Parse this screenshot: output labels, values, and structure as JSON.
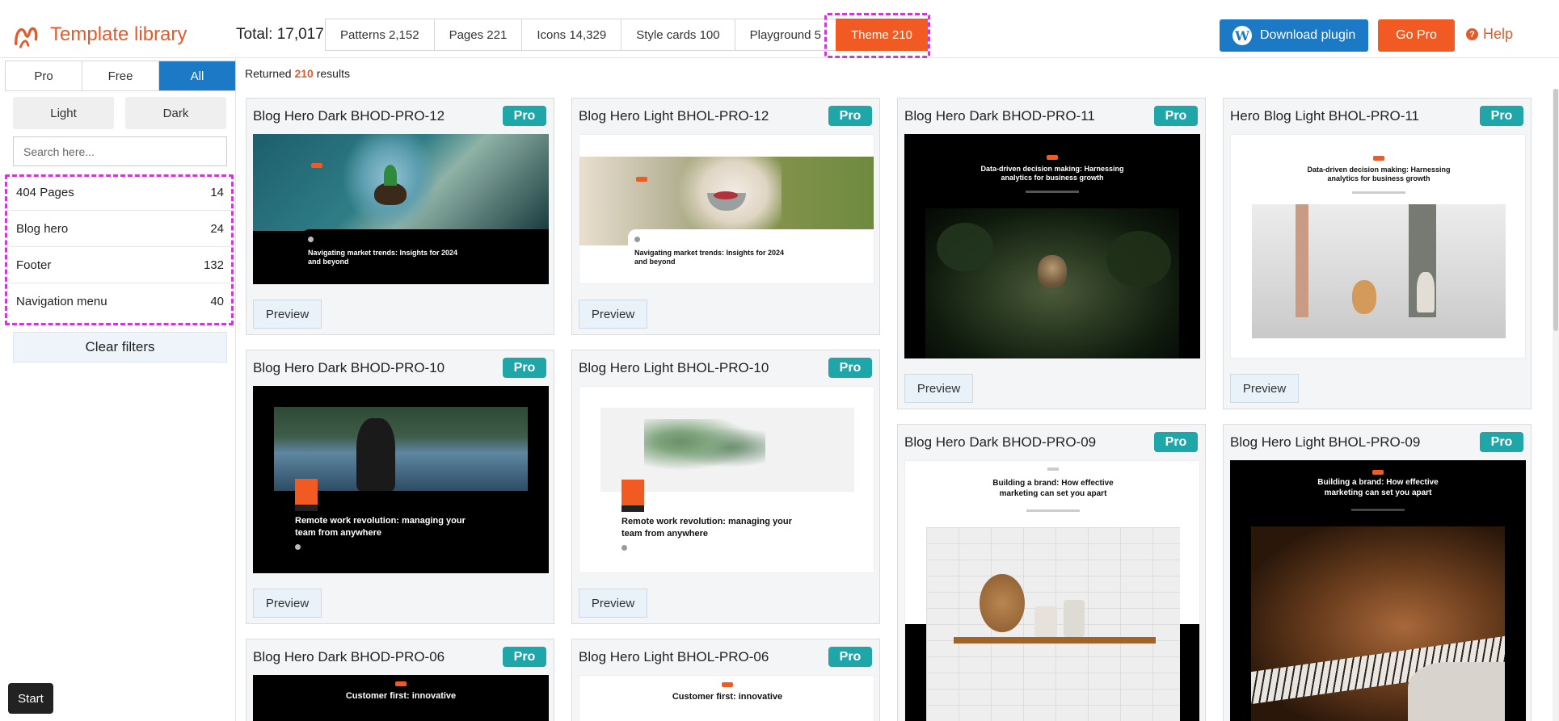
{
  "header": {
    "logo_text": "Template library",
    "total": "Total: 17,017",
    "tabs": [
      {
        "label": "Patterns 2,152"
      },
      {
        "label": "Pages 221"
      },
      {
        "label": "Icons 14,329"
      },
      {
        "label": "Style cards 100"
      },
      {
        "label": "Playground 5"
      },
      {
        "label": "Theme 210"
      }
    ],
    "download_label": "Download plugin",
    "gopro_label": "Go Pro",
    "help_label": "Help"
  },
  "sidebar": {
    "segments": [
      "Pro",
      "Free",
      "All"
    ],
    "theme_toggle": [
      "Light",
      "Dark"
    ],
    "search_placeholder": "Search here...",
    "categories": [
      {
        "name": "404 Pages",
        "count": "14"
      },
      {
        "name": "Blog hero",
        "count": "24"
      },
      {
        "name": "Footer",
        "count": "132"
      },
      {
        "name": "Navigation menu",
        "count": "40"
      }
    ],
    "clear_label": "Clear filters",
    "start_label": "Start"
  },
  "main": {
    "results_prefix": "Returned ",
    "results_count": "210",
    "results_suffix": " results",
    "badge": "Pro",
    "preview_label": "Preview",
    "cards": [
      {
        "title": "Blog Hero Dark BHOD-PRO-12",
        "headline": "Navigating market trends: Insights for 2024 and beyond"
      },
      {
        "title": "Blog Hero Light BHOL-PRO-12",
        "headline": "Navigating market trends: Insights for 2024 and beyond"
      },
      {
        "title": "Blog Hero Dark BHOD-PRO-11",
        "headline": "Data-driven decision making: Harnessing analytics for business growth"
      },
      {
        "title": "Hero Blog Light BHOL-PRO-11",
        "headline": "Data-driven decision making: Harnessing analytics for business growth"
      },
      {
        "title": "Blog Hero Dark BHOD-PRO-10",
        "headline": "Remote work revolution: managing your team from anywhere"
      },
      {
        "title": "Blog Hero Light BHOL-PRO-10",
        "headline": "Remote work revolution: managing your team from anywhere"
      },
      {
        "title": "Blog Hero Dark BHOD-PRO-09",
        "headline": "Building a brand: How effective marketing can set you apart"
      },
      {
        "title": "Blog Hero Light BHOL-PRO-09",
        "headline": "Building a brand: How effective marketing can set you apart"
      },
      {
        "title": "Blog Hero Dark BHOD-PRO-06",
        "headline": "Customer first: innovative"
      },
      {
        "title": "Blog Hero Light BHOL-PRO-06",
        "headline": "Customer first: innovative"
      }
    ]
  }
}
